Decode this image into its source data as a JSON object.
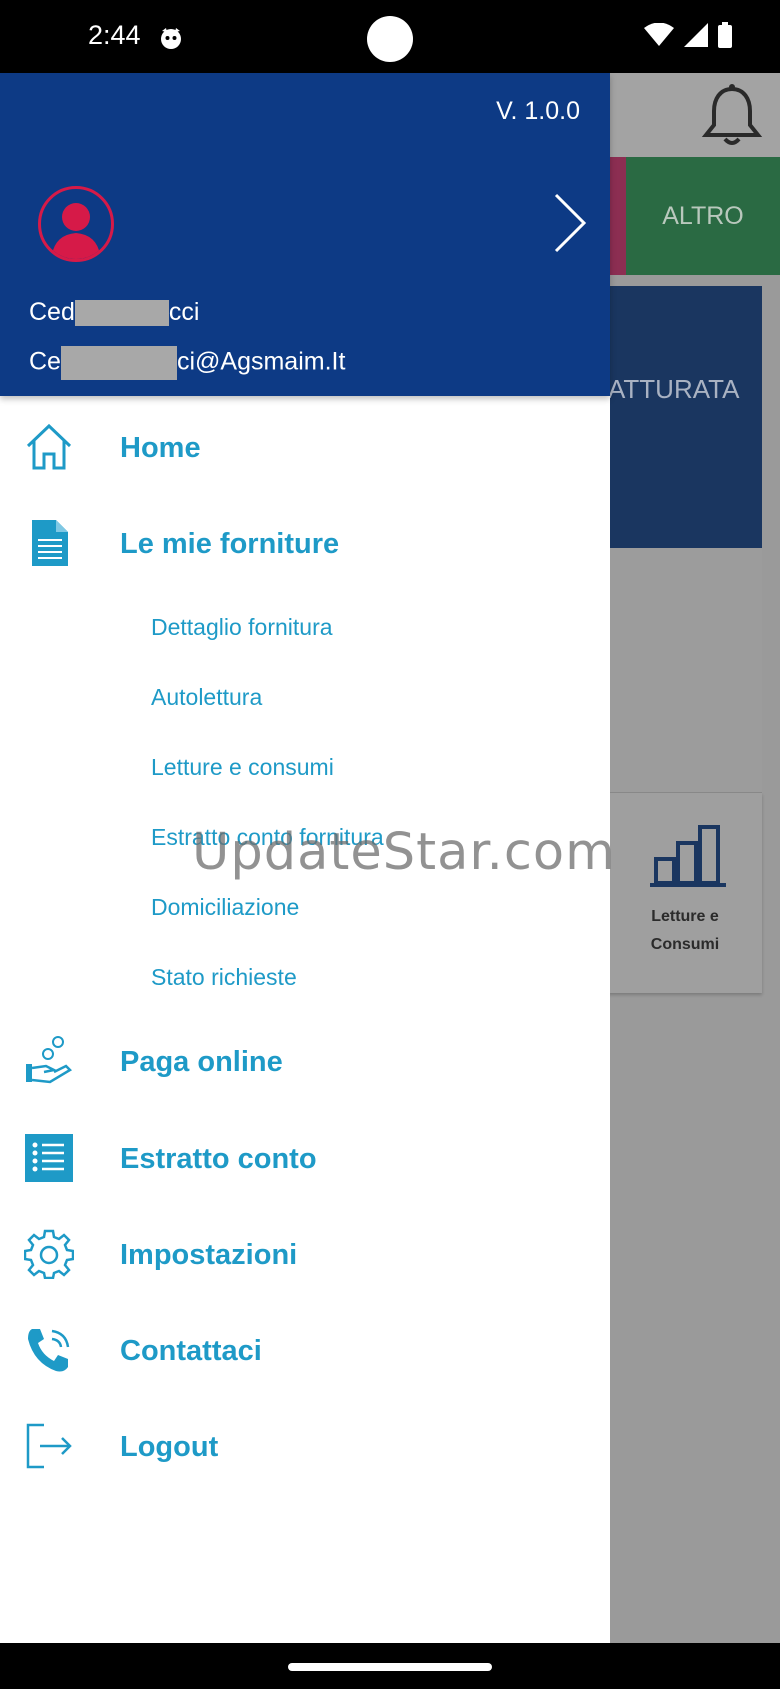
{
  "status_bar": {
    "time": "2:44"
  },
  "background": {
    "tab_altro": "ALTRO",
    "card_partial_text": "ATTURATA",
    "card_letture_line1": "Letture e",
    "card_letture_line2": "Consumi"
  },
  "drawer": {
    "version": "V. 1.0.0",
    "user_name_start": "Ced",
    "user_name_end": "cci",
    "user_email_start": "Ce",
    "user_email_end": "ci@Agsmaim.It",
    "menu": {
      "home": "Home",
      "forniture": "Le mie forniture",
      "sub": {
        "dettaglio": "Dettaglio fornitura",
        "autolettura": "Autolettura",
        "letture": "Letture e consumi",
        "estratto_fornitura": "Estratto conto fornitura",
        "domiciliazione": "Domiciliazione",
        "stato": "Stato richieste"
      },
      "paga": "Paga online",
      "estratto": "Estratto conto",
      "impostazioni": "Impostazioni",
      "contattaci": "Contattaci",
      "logout": "Logout"
    }
  },
  "watermark": "UpdateStar.com",
  "colors": {
    "header_bg": "#0d3a85",
    "accent": "#1e9ac7",
    "avatar": "#d61a48"
  }
}
